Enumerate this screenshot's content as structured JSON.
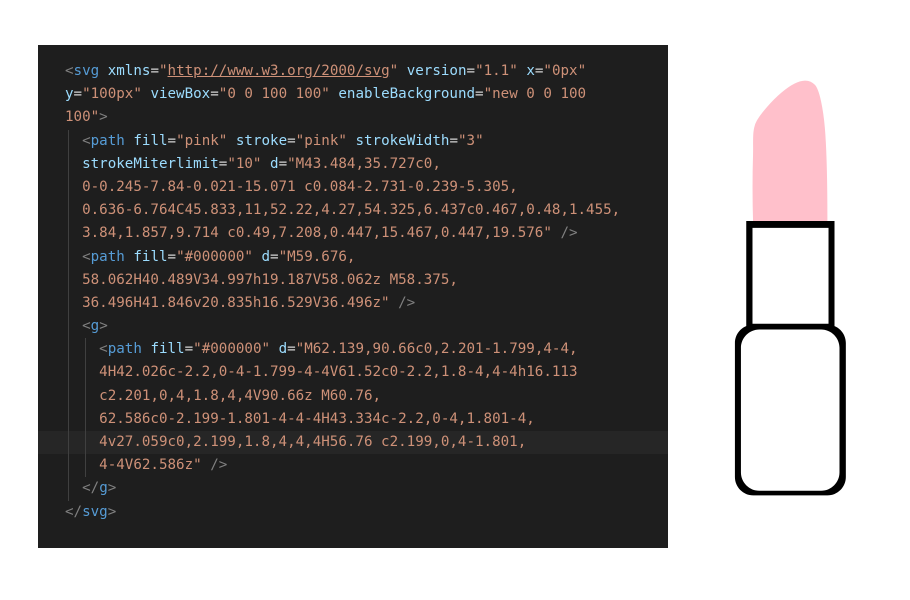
{
  "code_lines": [
    {
      "guides": 0,
      "tokens": [
        [
          "bracket",
          "<"
        ],
        [
          "tag",
          "svg"
        ],
        [
          "txt",
          " "
        ],
        [
          "attr",
          "xmlns"
        ],
        [
          "txt",
          "="
        ],
        [
          "val",
          "\""
        ],
        [
          "url",
          "http://www.w3.org/2000/svg"
        ],
        [
          "val",
          "\""
        ],
        [
          "txt",
          " "
        ],
        [
          "attr",
          "version"
        ],
        [
          "txt",
          "="
        ],
        [
          "val",
          "\"1.1\""
        ],
        [
          "txt",
          " "
        ],
        [
          "attr",
          "x"
        ],
        [
          "txt",
          "="
        ],
        [
          "val",
          "\"0px\""
        ]
      ]
    },
    {
      "guides": 0,
      "tokens": [
        [
          "attr",
          "y"
        ],
        [
          "txt",
          "="
        ],
        [
          "val",
          "\"100px\""
        ],
        [
          "txt",
          " "
        ],
        [
          "attr",
          "viewBox"
        ],
        [
          "txt",
          "="
        ],
        [
          "val",
          "\"0 0 100 100\""
        ],
        [
          "txt",
          " "
        ],
        [
          "attr",
          "enableBackground"
        ],
        [
          "txt",
          "="
        ],
        [
          "val",
          "\"new 0 0 100"
        ]
      ]
    },
    {
      "guides": 0,
      "tokens": [
        [
          "val",
          "100\""
        ],
        [
          "bracket",
          ">"
        ]
      ]
    },
    {
      "guides": 1,
      "tokens": [
        [
          "txt",
          "  "
        ],
        [
          "bracket",
          "<"
        ],
        [
          "tag",
          "path"
        ],
        [
          "txt",
          " "
        ],
        [
          "attr",
          "fill"
        ],
        [
          "txt",
          "="
        ],
        [
          "val",
          "\"pink\""
        ],
        [
          "txt",
          " "
        ],
        [
          "attr",
          "stroke"
        ],
        [
          "txt",
          "="
        ],
        [
          "val",
          "\"pink\""
        ],
        [
          "txt",
          " "
        ],
        [
          "attr",
          "strokeWidth"
        ],
        [
          "txt",
          "="
        ],
        [
          "val",
          "\"3\""
        ]
      ]
    },
    {
      "guides": 1,
      "tokens": [
        [
          "txt",
          "  "
        ],
        [
          "attr",
          "strokeMiterlimit"
        ],
        [
          "txt",
          "="
        ],
        [
          "val",
          "\"10\""
        ],
        [
          "txt",
          " "
        ],
        [
          "attr",
          "d"
        ],
        [
          "txt",
          "="
        ],
        [
          "val",
          "\"M43.484,35.727c0,"
        ]
      ]
    },
    {
      "guides": 1,
      "tokens": [
        [
          "txt",
          "  "
        ],
        [
          "val",
          "0-0.245-7.84-0.021-15.071 c0.084-2.731-0.239-5.305,"
        ]
      ]
    },
    {
      "guides": 1,
      "tokens": [
        [
          "txt",
          "  "
        ],
        [
          "val",
          "0.636-6.764C45.833,11,52.22,4.27,54.325,6.437c0.467,0.48,1.455,"
        ]
      ]
    },
    {
      "guides": 1,
      "tokens": [
        [
          "txt",
          "  "
        ],
        [
          "val",
          "3.84,1.857,9.714 c0.49,7.208,0.447,15.467,0.447,19.576\""
        ],
        [
          "txt",
          " "
        ],
        [
          "bracket",
          "/>"
        ]
      ]
    },
    {
      "guides": 1,
      "tokens": [
        [
          "txt",
          "  "
        ],
        [
          "bracket",
          "<"
        ],
        [
          "tag",
          "path"
        ],
        [
          "txt",
          " "
        ],
        [
          "attr",
          "fill"
        ],
        [
          "txt",
          "="
        ],
        [
          "val",
          "\"#000000\""
        ],
        [
          "txt",
          " "
        ],
        [
          "attr",
          "d"
        ],
        [
          "txt",
          "="
        ],
        [
          "val",
          "\"M59.676,"
        ]
      ]
    },
    {
      "guides": 1,
      "tokens": [
        [
          "txt",
          "  "
        ],
        [
          "val",
          "58.062H40.489V34.997h19.187V58.062z M58.375,"
        ]
      ]
    },
    {
      "guides": 1,
      "tokens": [
        [
          "txt",
          "  "
        ],
        [
          "val",
          "36.496H41.846v20.835h16.529V36.496z\""
        ],
        [
          "txt",
          " "
        ],
        [
          "bracket",
          "/>"
        ]
      ]
    },
    {
      "guides": 1,
      "tokens": [
        [
          "txt",
          "  "
        ],
        [
          "bracket",
          "<"
        ],
        [
          "tag",
          "g"
        ],
        [
          "bracket",
          ">"
        ]
      ]
    },
    {
      "guides": 2,
      "tokens": [
        [
          "txt",
          "    "
        ],
        [
          "bracket",
          "<"
        ],
        [
          "tag",
          "path"
        ],
        [
          "txt",
          " "
        ],
        [
          "attr",
          "fill"
        ],
        [
          "txt",
          "="
        ],
        [
          "val",
          "\"#000000\""
        ],
        [
          "txt",
          " "
        ],
        [
          "attr",
          "d"
        ],
        [
          "txt",
          "="
        ],
        [
          "val",
          "\"M62.139,90.66c0,2.201-1.799,4-4,"
        ]
      ]
    },
    {
      "guides": 2,
      "tokens": [
        [
          "txt",
          "    "
        ],
        [
          "val",
          "4H42.026c-2.2,0-4-1.799-4-4V61.52c0-2.2,1.8-4,4-4h16.113"
        ]
      ]
    },
    {
      "guides": 2,
      "tokens": [
        [
          "txt",
          "    "
        ],
        [
          "val",
          "c2.201,0,4,1.8,4,4V90.66z M60.76,"
        ]
      ]
    },
    {
      "guides": 2,
      "tokens": [
        [
          "txt",
          "    "
        ],
        [
          "val",
          "62.586c0-2.199-1.801-4-4-4H43.334c-2.2,0-4,1.801-4,"
        ]
      ]
    },
    {
      "guides": 2,
      "highlight": true,
      "tokens": [
        [
          "txt",
          "    "
        ],
        [
          "val",
          "4v27.059c0,2.199,1.8,4,4,4H56.76 c2.199,0,4-1.801,"
        ]
      ]
    },
    {
      "guides": 2,
      "tokens": [
        [
          "txt",
          "    "
        ],
        [
          "val",
          "4-4V62.586z\""
        ],
        [
          "txt",
          " "
        ],
        [
          "bracket",
          "/>"
        ]
      ]
    },
    {
      "guides": 1,
      "tokens": [
        [
          "txt",
          "  "
        ],
        [
          "bracket",
          "</"
        ],
        [
          "tag",
          "g"
        ],
        [
          "bracket",
          ">"
        ]
      ]
    },
    {
      "guides": 0,
      "tokens": [
        [
          "bracket",
          "</"
        ],
        [
          "tag",
          "svg"
        ],
        [
          "bracket",
          ">"
        ]
      ]
    }
  ],
  "colors": {
    "editor_bg": "#1e1e1e",
    "tag": "#569cd6",
    "attribute": "#9cdcfe",
    "string": "#ce9178",
    "lipstick_fill": "pink",
    "outline": "#000000"
  },
  "preview": {
    "icon": "lipstick-icon"
  }
}
